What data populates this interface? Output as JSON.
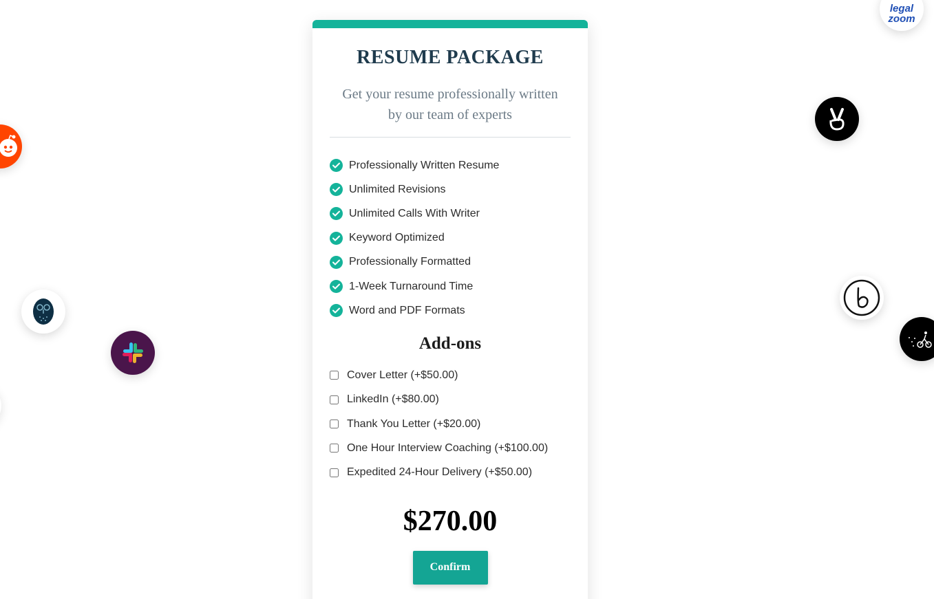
{
  "card": {
    "title": "RESUME PACKAGE",
    "subtitle": "Get your resume professionally written by our team of experts",
    "accent_color": "#14b39a"
  },
  "features": [
    "Professionally Written Resume",
    "Unlimited Revisions",
    "Unlimited Calls With Writer",
    "Keyword Optimized",
    "Professionally Formatted",
    "1-Week Turnaround Time",
    "Word and PDF Formats"
  ],
  "addons": {
    "title": "Add-ons",
    "items": [
      {
        "label": "Cover Letter (+$50.00)",
        "checked": false
      },
      {
        "label": "LinkedIn (+$80.00)",
        "checked": false
      },
      {
        "label": "Thank You Letter (+$20.00)",
        "checked": false
      },
      {
        "label": "One Hour Interview Coaching (+$100.00)",
        "checked": false
      },
      {
        "label": "Expedited 24-Hour Delivery (+$50.00)",
        "checked": false
      }
    ]
  },
  "total": "$270.00",
  "confirm_label": "Confirm",
  "logos": {
    "legalzoom_line1": "legal",
    "legalzoom_line2": "zoom",
    "icons": [
      "reddit-logo-icon",
      "owl-logo-icon",
      "slack-logo-icon",
      "legalzoom-logo-icon",
      "angellist-logo-icon",
      "bold-b-logo-icon",
      "postmates-logo-icon"
    ]
  }
}
